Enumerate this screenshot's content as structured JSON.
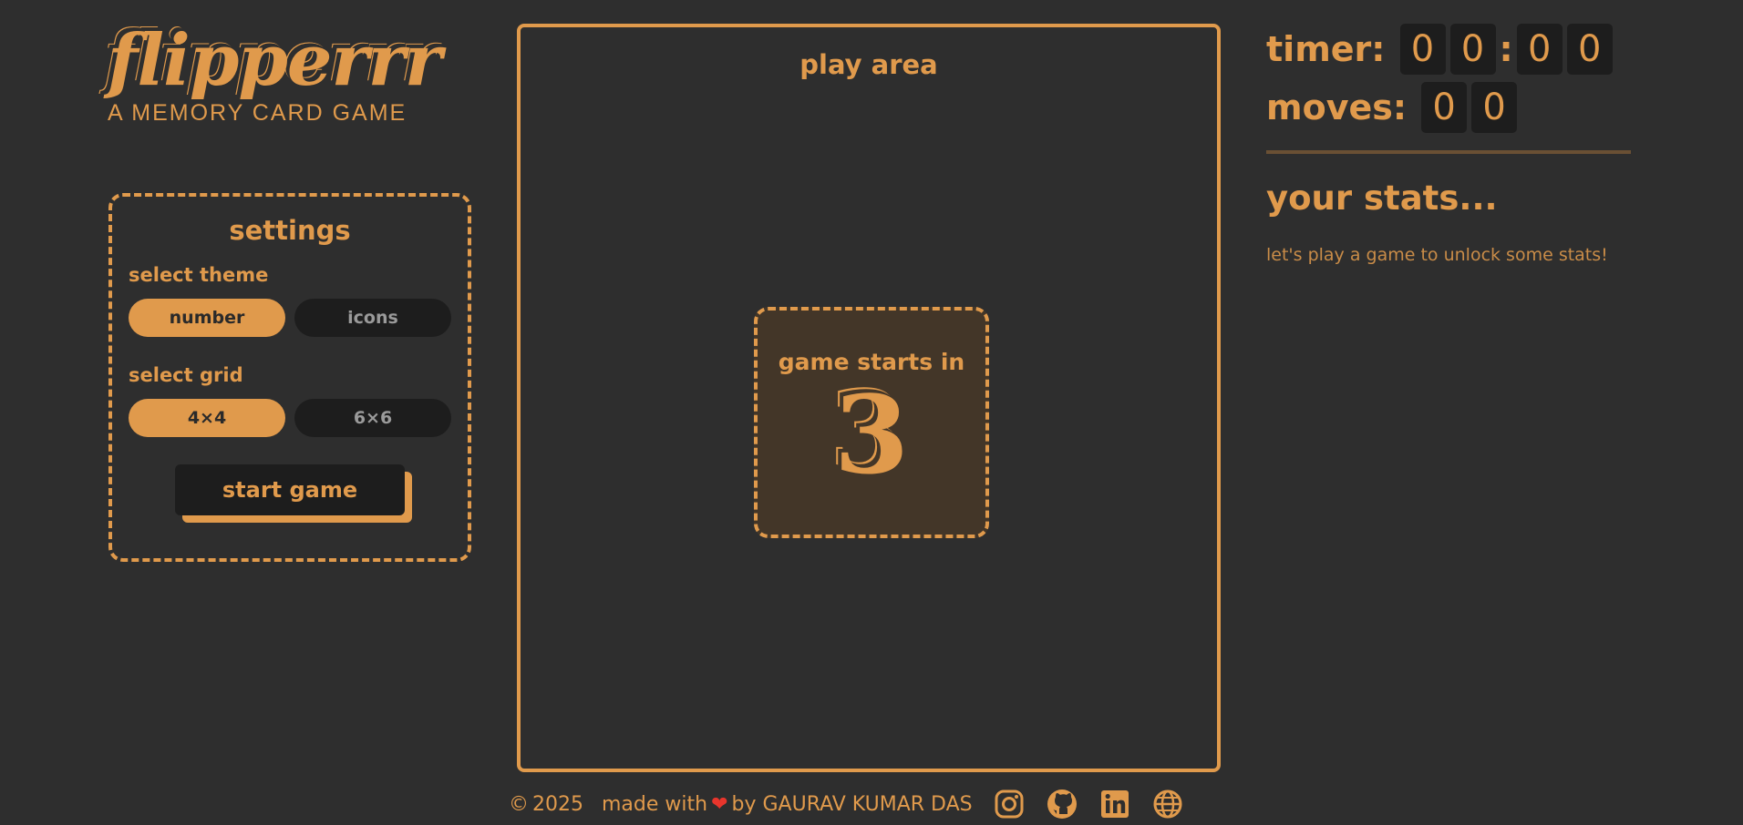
{
  "brand": {
    "title": "flipperrr",
    "subtitle": "A MEMORY CARD GAME"
  },
  "settings": {
    "title": "settings",
    "theme": {
      "label": "select theme",
      "options": [
        "number",
        "icons"
      ],
      "selected": "number"
    },
    "grid": {
      "label": "select grid",
      "options": [
        "4×4",
        "6×6"
      ],
      "selected": "4×4"
    },
    "start_label": "start game"
  },
  "play_area": {
    "title": "play area",
    "countdown_label": "game starts in",
    "countdown_value": "3"
  },
  "status": {
    "timer_label": "timer:",
    "timer_digits": [
      "0",
      "0",
      "0",
      "0"
    ],
    "timer_separator": ":",
    "moves_label": "moves:",
    "moves_digits": [
      "0",
      "0"
    ]
  },
  "stats": {
    "title": "your stats...",
    "empty_message": "let's play a game to unlock some stats!"
  },
  "footer": {
    "copyright_symbol": "©",
    "year": "2025",
    "made_with": "made with",
    "heart": "❤",
    "by": "by GAURAV KUMAR DAS",
    "icons": [
      "instagram-icon",
      "github-icon",
      "linkedin-icon",
      "globe-icon"
    ]
  },
  "colors": {
    "background": "#2e2e2e",
    "accent": "#e09a4c",
    "dark": "#1d1d1d",
    "heart": "#e8352c"
  }
}
